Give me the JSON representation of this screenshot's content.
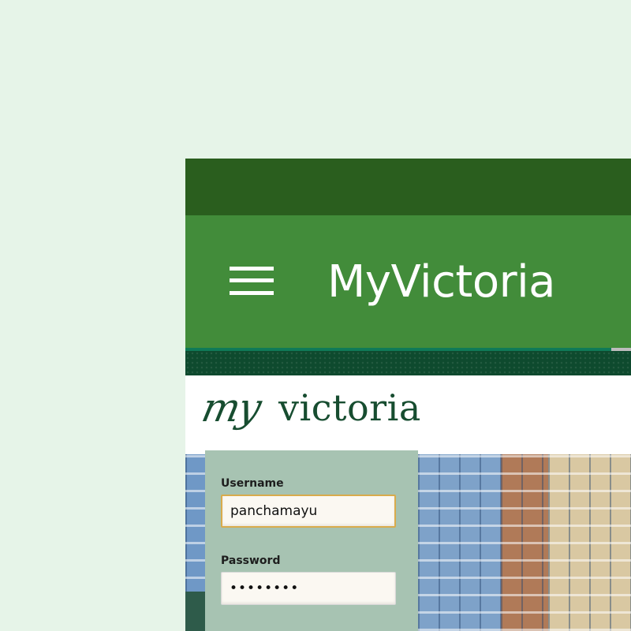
{
  "app_bar": {
    "menu_icon": "hamburger-menu-icon",
    "title": "MyVictoria"
  },
  "page_progress": 0.956,
  "logo": {
    "my": "my",
    "victoria": "victoria"
  },
  "login": {
    "username_label": "Username",
    "username_value": "panchamayu",
    "password_label": "Password",
    "password_value": "••••••••"
  },
  "colors": {
    "status_bar": "#2a5e1e",
    "app_bar": "#428c3a",
    "brand_dark_green": "#174d30",
    "input_focus_border": "#d9ab4c"
  }
}
